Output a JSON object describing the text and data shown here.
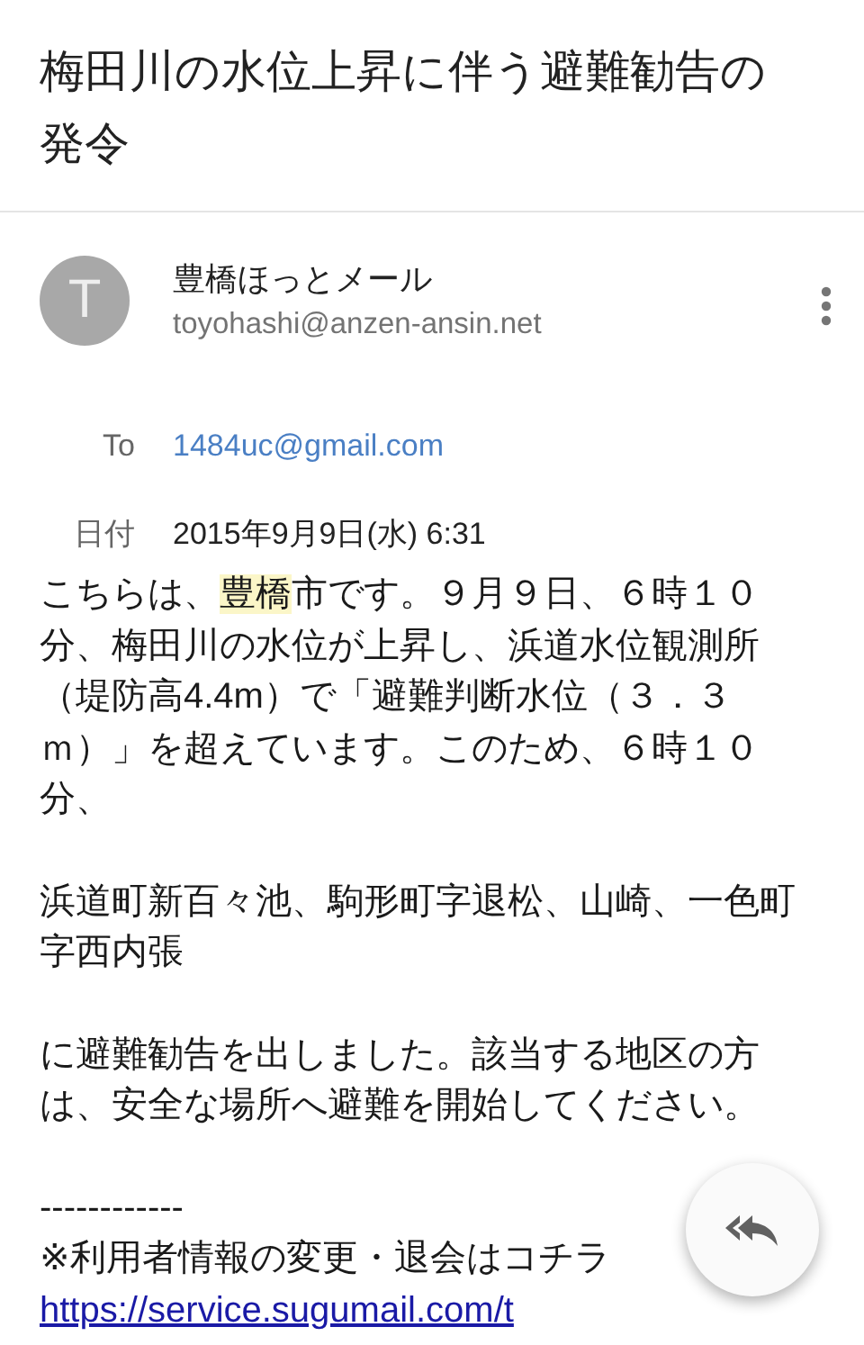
{
  "title": "梅田川の水位上昇に伴う避難勧告の発令",
  "sender": {
    "initial": "T",
    "name": "豊橋ほっとメール",
    "address": "toyohashi@anzen-ansin.net"
  },
  "fields": [
    {
      "label": "To",
      "value": "1484uc@gmail.com",
      "kind": "link"
    },
    {
      "label": "日付",
      "value": "2015年9月9日(水) 6:31",
      "kind": "text"
    }
  ],
  "body": [
    {
      "lines": [
        [
          {
            "text": "こちらは、",
            "highlighted": false
          },
          {
            "text": "豊橋",
            "highlighted": true
          },
          {
            "text": "市です。９月９日、６時１０",
            "highlighted": false
          }
        ],
        [
          {
            "text": "分、梅田川の水位が上昇し、浜道水位観測所",
            "highlighted": false
          }
        ],
        [
          {
            "text": "（堤防高4.4m）で「避難判断水位（３．３",
            "highlighted": false
          }
        ],
        [
          {
            "text": "ｍ）」を超えています。このため、６時１０",
            "highlighted": false
          }
        ],
        [
          {
            "text": "分、",
            "highlighted": false
          }
        ]
      ]
    },
    {
      "lines": [
        [
          {
            "text": "浜道町新百々池、駒形町字退松、山崎、一色町",
            "highlighted": false
          }
        ],
        [
          {
            "text": "字西内張",
            "highlighted": false
          }
        ]
      ]
    },
    {
      "lines": [
        [
          {
            "text": "に避難勧告を出しました。該当する地区の方",
            "highlighted": false
          }
        ],
        [
          {
            "text": "は、安全な場所へ避難を開始してください。",
            "highlighted": false
          }
        ]
      ]
    },
    {
      "lines": [
        [
          {
            "text": "------------",
            "highlighted": false
          }
        ],
        [
          {
            "text": "※利用者情報の変更・退会はコチラ",
            "highlighted": false
          }
        ]
      ]
    }
  ],
  "footer_link": "https://service.sugumail.com/t"
}
